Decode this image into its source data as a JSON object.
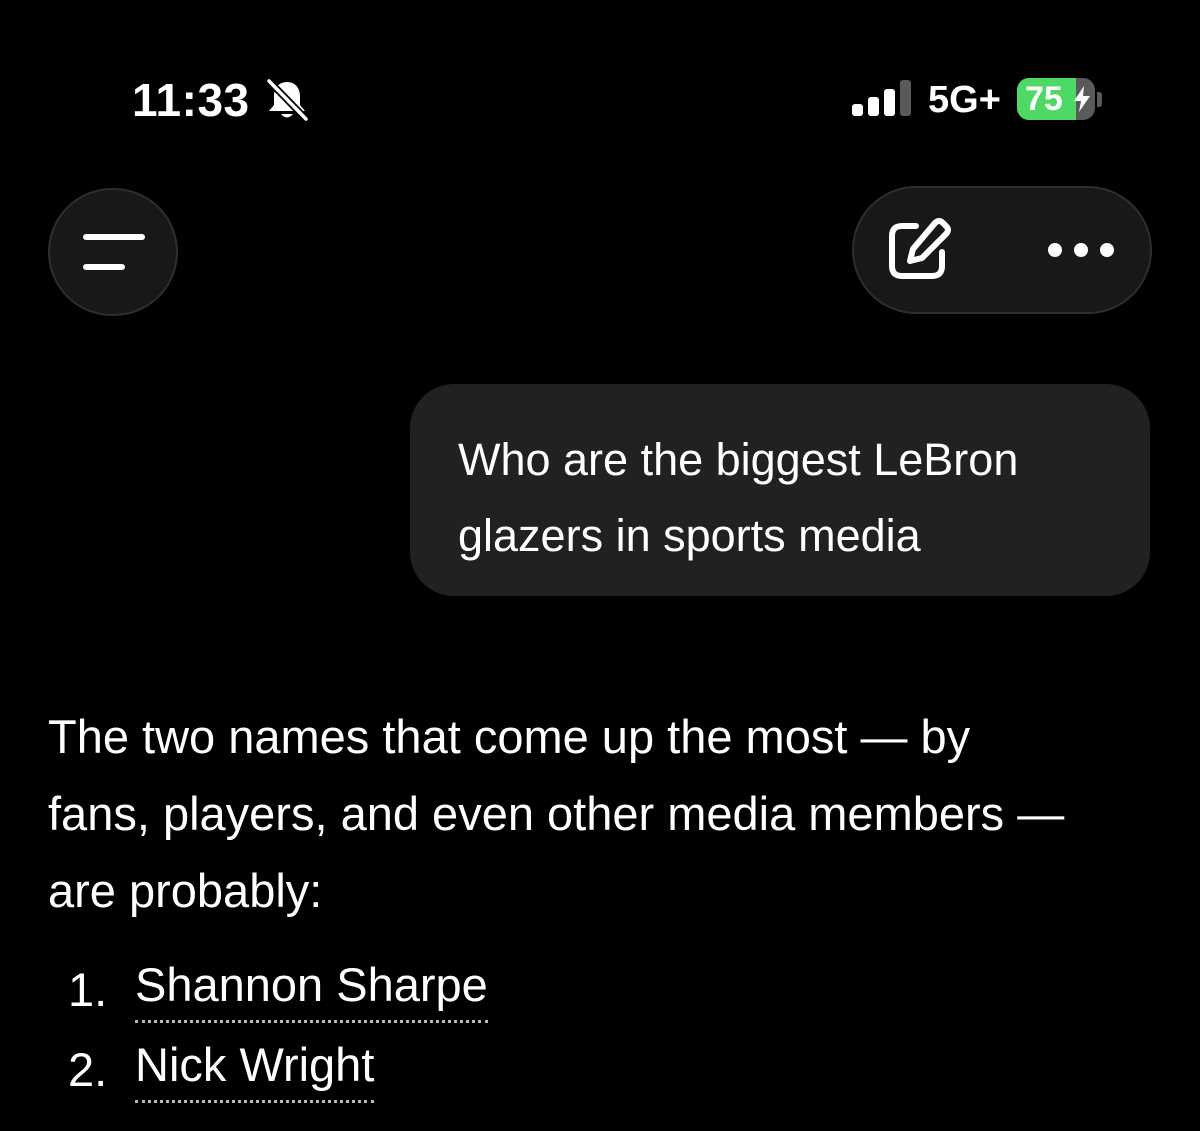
{
  "status_bar": {
    "time": "11:33",
    "network": "5G+",
    "battery_percent": "75",
    "battery_level": 0.75,
    "signal_bars_active": 3,
    "signal_bars_total": 4
  },
  "nav": {
    "menu_icon": "menu-lines-icon",
    "edit_icon": "edit-pencil-icon",
    "more_icon": "more-dots-icon"
  },
  "conversation": {
    "user_message": "Who are the biggest LeBron\nglazers in sports media",
    "assistant_intro": "The two names that come up the most — by\nfans, players, and even other media members —\nare probably:",
    "list": [
      {
        "number": "1.",
        "name": "Shannon Sharpe"
      },
      {
        "number": "2.",
        "name": "Nick Wright"
      }
    ]
  },
  "colors": {
    "background": "#000000",
    "bubble": "#212121",
    "battery_green": "#4cd964",
    "text": "#ffffff"
  }
}
